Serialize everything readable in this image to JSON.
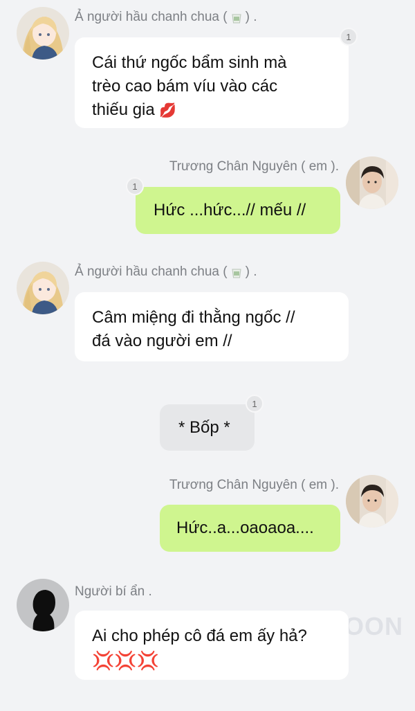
{
  "messages": [
    {
      "sender": "Ả người hầu chanh chua (",
      "sender_suffix": ") .",
      "sender_icon": "tea-cup-icon",
      "text": "Cái thứ ngốc bẩm sinh mà trèo cao bám víu vào các thiếu gia 🫦",
      "line1": "Cái thứ ngốc bẩm sinh mà",
      "line2": "trèo cao bám víu vào các",
      "line3": "thiếu gia",
      "emoji": "💋",
      "read_count": "1"
    },
    {
      "sender": "Trương Chân Nguyên ( em ).",
      "text": "Hức ...hức...// mếu //",
      "read_count": "1"
    },
    {
      "sender": "Ả người hầu chanh chua (",
      "sender_suffix": ") .",
      "sender_icon": "tea-cup-icon",
      "line1": "Câm miệng đi thằng ngốc //",
      "line2": "đá vào người em //"
    },
    {
      "text": "* Bốp *",
      "read_count": "1"
    },
    {
      "sender": "Trương Chân Nguyên ( em ).",
      "text": "Hức..a...oaoaoa...."
    },
    {
      "sender": "Người bí ẩn .",
      "line1": "Ai cho phép cô  đá em ấy hả?",
      "emoji": "💢💢💢"
    }
  ],
  "watermark": "OON",
  "colors": {
    "background": "#f2f3f5",
    "my_bubble": "#cff58f",
    "other_bubble": "#ffffff",
    "sender_text": "#7c7f84"
  }
}
